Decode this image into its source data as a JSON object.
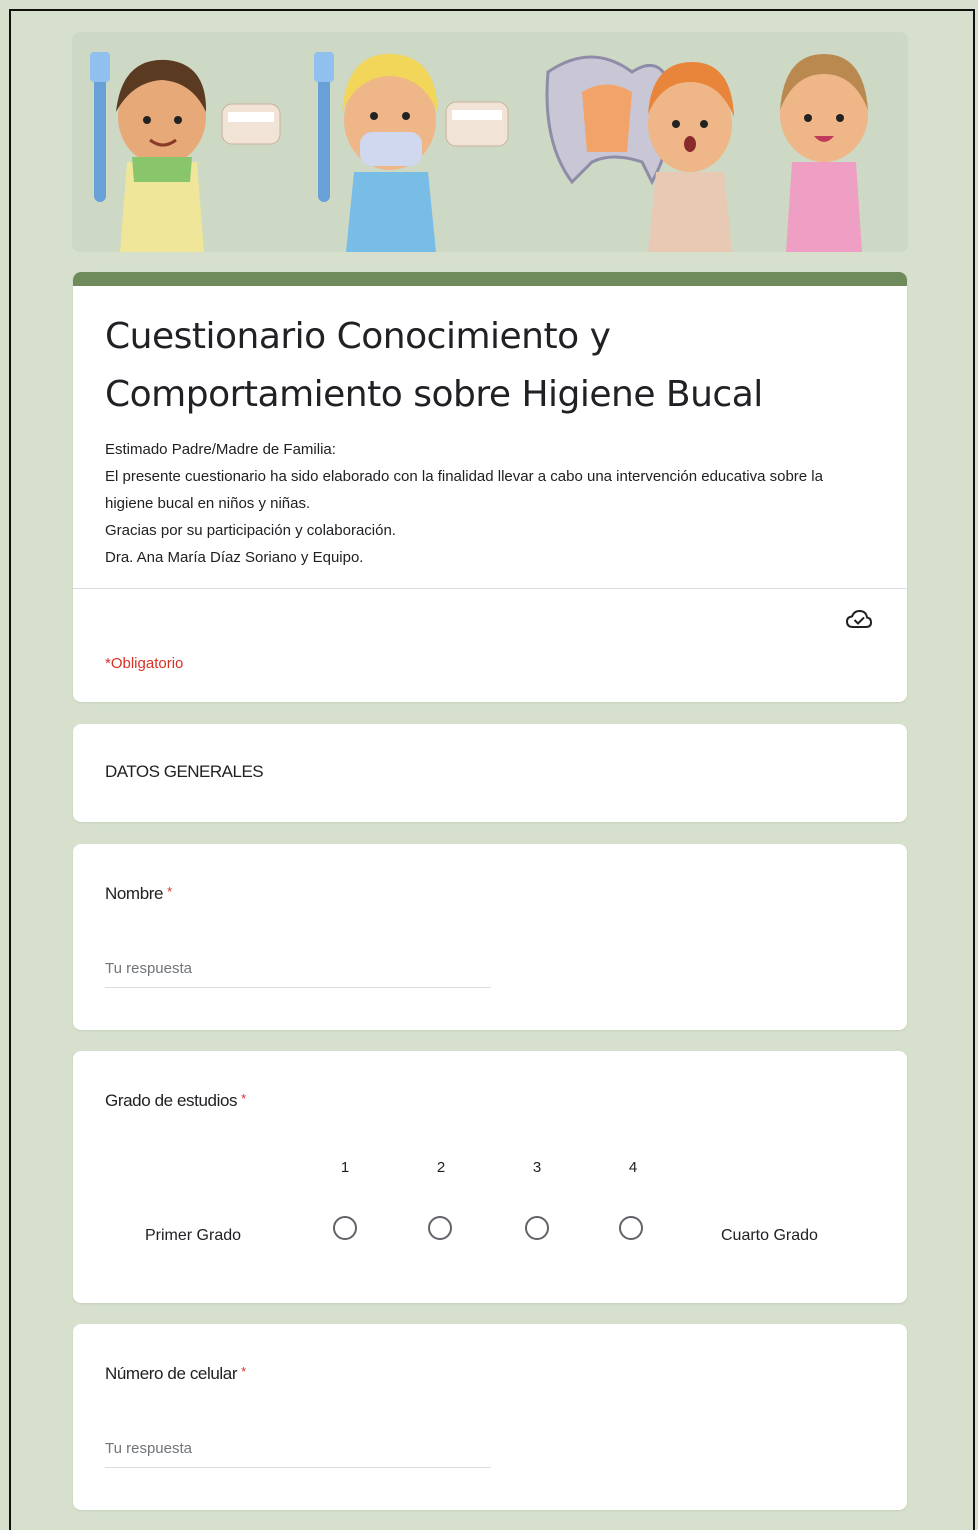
{
  "form": {
    "title": "Cuestionario Conocimiento y Comportamiento sobre Higiene Bucal",
    "description": "Estimado Padre/Madre de Familia:\nEl presente cuestionario ha sido elaborado con la finalidad llevar a cabo una intervención educativa sobre la higiene bucal en niños y niñas.\nGracias por su participación y colaboración.\nDra. Ana María Díaz Soriano y Equipo.",
    "required_note": "*Obligatorio",
    "accent_color": "#6f8a5b",
    "background_color": "#d6e0cd"
  },
  "section": {
    "label": "DATOS GENERALES"
  },
  "questions": {
    "nombre": {
      "label": "Nombre",
      "required_mark": "*",
      "placeholder": "Tu respuesta"
    },
    "grado": {
      "label": "Grado de estudios",
      "required_mark": "*",
      "scale": [
        "1",
        "2",
        "3",
        "4"
      ],
      "low_label": "Primer Grado",
      "high_label": "Cuarto Grado"
    },
    "celular": {
      "label": "Número de celular",
      "required_mark": "*",
      "placeholder": "Tu respuesta"
    }
  },
  "icons": {
    "banner": "dental-kids-banner",
    "save_status": "cloud-check-icon"
  }
}
